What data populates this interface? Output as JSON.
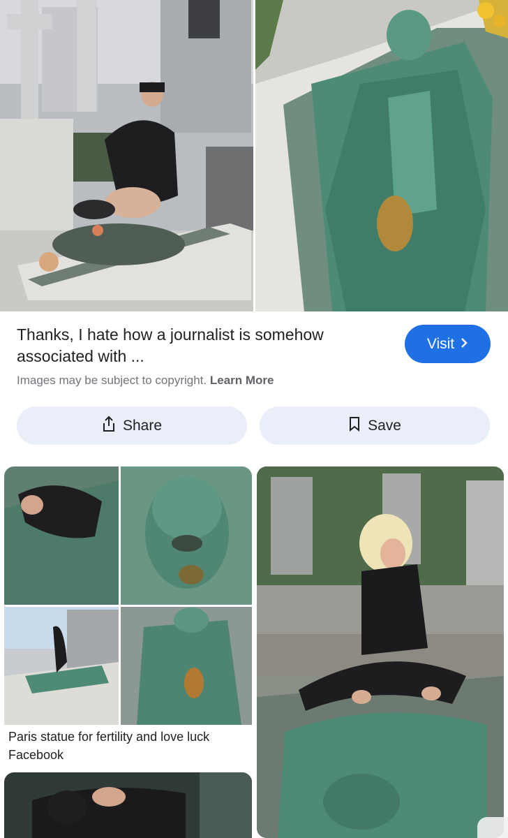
{
  "result": {
    "title": "Thanks, I hate how a journalist is somehow associated with ...",
    "visit_label": "Visit",
    "copyright_text": "Images may be subject to copyright.",
    "learn_more_label": "Learn More"
  },
  "actions": {
    "share_label": "Share",
    "save_label": "Save"
  },
  "related": [
    {
      "title": "Paris statue for fertility and love luck",
      "source": "Facebook"
    }
  ],
  "colors": {
    "accent": "#1f6fe5",
    "pill_bg": "#e9eef8",
    "statue_green": "#4e8b77"
  }
}
